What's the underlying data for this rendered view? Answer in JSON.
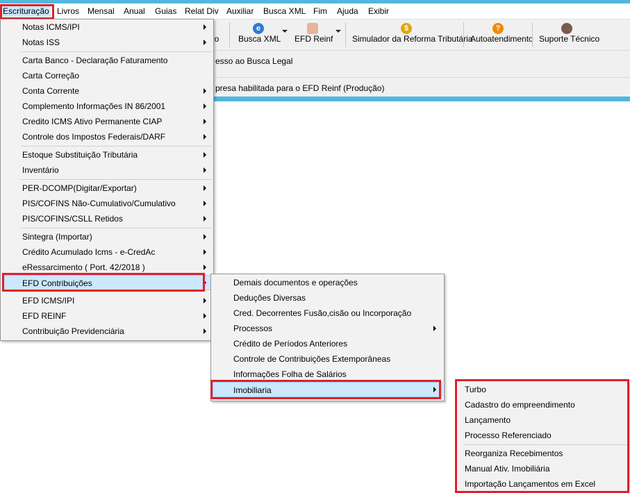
{
  "menubar": {
    "items": [
      "Escrituração",
      "Livros",
      "Mensal",
      "Anual",
      "Guias",
      "Relat Div",
      "Auxiliar",
      "Busca XML",
      "Fim",
      "Ajuda",
      "Exibir"
    ]
  },
  "toolbar": {
    "partial_label": "io",
    "busca_xml": "Busca XML",
    "efd_reinf": "EFD Reinf",
    "simulador": "Simulador da Reforma Tributária",
    "autoatendimento": "Autoatendimento",
    "suporte": "Suporte Técnico"
  },
  "info": {
    "line1": "esso ao Busca Legal",
    "line2": "presa habilitada para o EFD Reinf (Produção)"
  },
  "menu1": {
    "items": [
      "Notas ICMS/IPI",
      "Notas ISS",
      "Carta Banco - Declaração Faturamento",
      "Carta Correção",
      "Conta Corrente",
      "Complemento Informações IN 86/2001",
      "Credito ICMS Ativo Permanente CIAP",
      "Controle dos Impostos Federais/DARF",
      "Estoque Substituição Tributária",
      "Inventário",
      "PER-DCOMP(Digitar/Exportar)",
      "PIS/COFINS Não-Cumulativo/Cumulativo",
      "PIS/COFINS/CSLL Retidos",
      "Sintegra (Importar)",
      "Crédito Acumulado Icms - e-CredAc",
      "eRessarcimento ( Port. 42/2018 )",
      "EFD Contribuições",
      "EFD ICMS/IPI",
      "EFD REINF",
      "Contribuição Previdenciária"
    ]
  },
  "menu2": {
    "items": [
      "Demais documentos e operações",
      "Deduções Diversas",
      "Cred. Decorrentes Fusão,cisão ou Incorporação",
      "Processos",
      "Crédito de Períodos Anteriores",
      "Controle de Contribuições Extemporâneas",
      "Informações Folha de Salários",
      "Imobiliaria"
    ]
  },
  "menu3": {
    "items": [
      "Turbo",
      "Cadastro do empreendimento",
      "Lançamento",
      "Processo Referenciado",
      "Reorganiza Recebimentos",
      "Manual Ativ. Imobiliária",
      "Importação Lançamentos em Excel"
    ]
  },
  "colors": {
    "highlight": "#cce8ff",
    "annotation_red": "#e0202a",
    "accent_blue": "#52b6dd"
  }
}
